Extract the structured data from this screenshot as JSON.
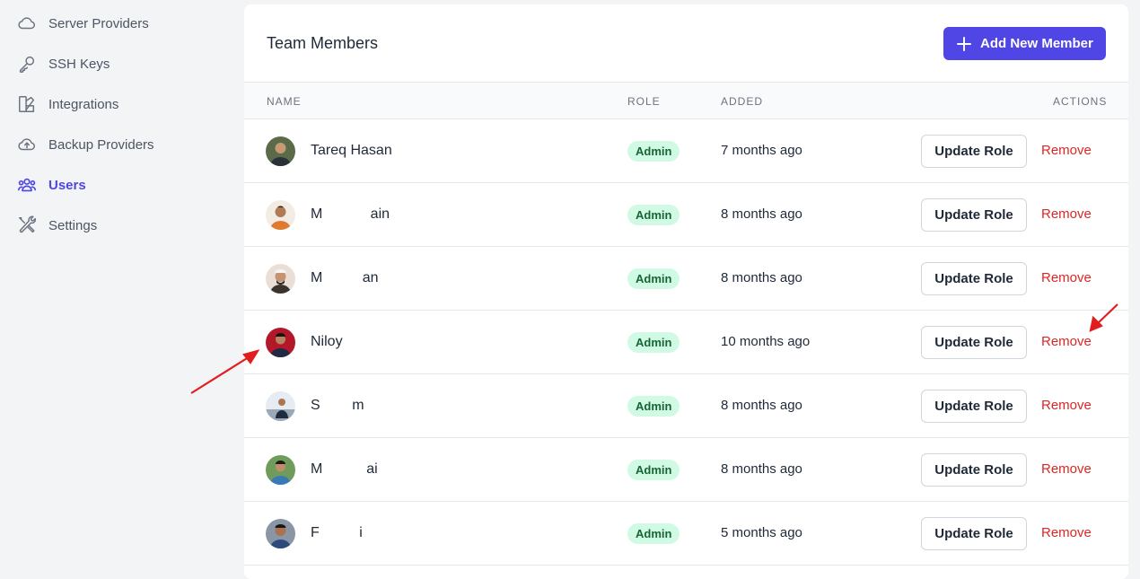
{
  "sidebar": {
    "items": [
      {
        "label": "Server Providers",
        "icon": "cloud-icon",
        "active": false
      },
      {
        "label": "SSH Keys",
        "icon": "key-icon",
        "active": false
      },
      {
        "label": "Integrations",
        "icon": "integrations-icon",
        "active": false
      },
      {
        "label": "Backup Providers",
        "icon": "cloud-upload-icon",
        "active": false
      },
      {
        "label": "Users",
        "icon": "users-icon",
        "active": true
      },
      {
        "label": "Settings",
        "icon": "tools-icon",
        "active": false
      }
    ]
  },
  "panel": {
    "title": "Team Members",
    "add_button_label": "Add New Member"
  },
  "table": {
    "headers": {
      "name": "NAME",
      "role": "ROLE",
      "added": "ADDED",
      "actions": "ACTIONS"
    },
    "rows": [
      {
        "name": "Tareq Hasan",
        "role": "Admin",
        "added": "7 months ago",
        "update": "Update Role",
        "remove": "Remove"
      },
      {
        "name": "M            ain",
        "role": "Admin",
        "added": "8 months ago",
        "update": "Update Role",
        "remove": "Remove"
      },
      {
        "name": "M          an",
        "role": "Admin",
        "added": "8 months ago",
        "update": "Update Role",
        "remove": "Remove"
      },
      {
        "name": "Niloy",
        "role": "Admin",
        "added": "10 months ago",
        "update": "Update Role",
        "remove": "Remove"
      },
      {
        "name": "S        m",
        "role": "Admin",
        "added": "8 months ago",
        "update": "Update Role",
        "remove": "Remove"
      },
      {
        "name": "M           ai",
        "role": "Admin",
        "added": "8 months ago",
        "update": "Update Role",
        "remove": "Remove"
      },
      {
        "name": "F          i",
        "role": "Admin",
        "added": "5 months ago",
        "update": "Update Role",
        "remove": "Remove"
      }
    ]
  },
  "colors": {
    "accent": "#4f46e5",
    "danger": "#dc2626",
    "badge_bg": "#d1fae5",
    "badge_text": "#166534",
    "annotation_arrow": "#e11d1d"
  }
}
